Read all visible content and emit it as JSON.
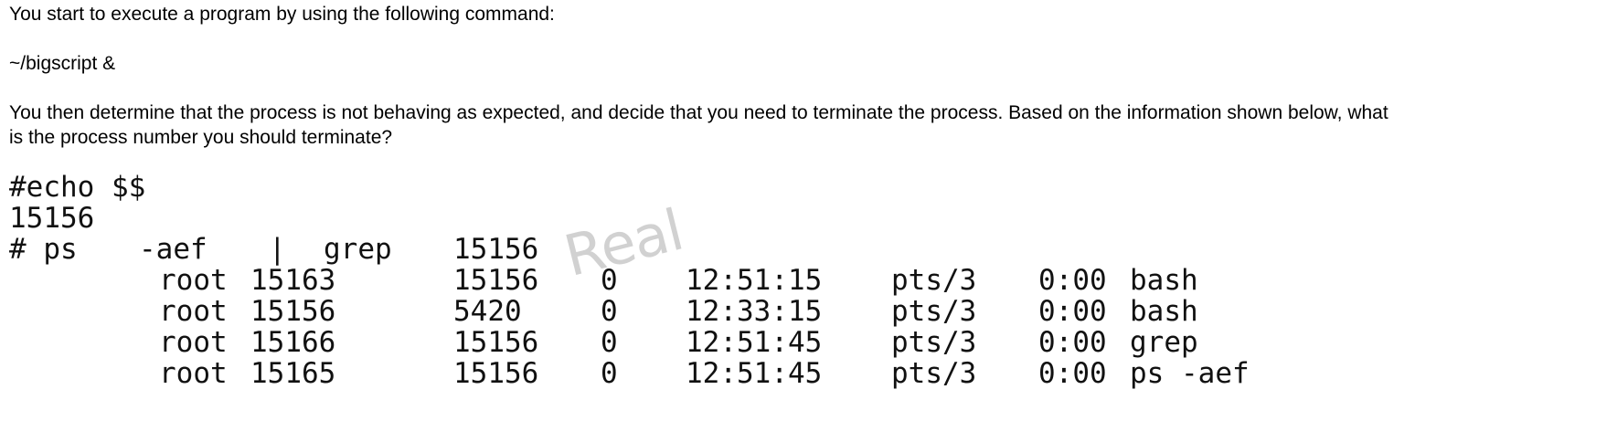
{
  "question": {
    "line1": "You start to execute a program by using the following command:",
    "command": "~/bigscript &",
    "line3a": "You then determine that the process is not behaving as expected, and decide that you need to terminate the process. Based on the information shown below, what",
    "line3b": "is the process number you should terminate?"
  },
  "terminal": {
    "echo_cmd": "#echo $$",
    "echo_output": "15156",
    "ps_prompt": "# ps",
    "ps_flags": "-aef",
    "ps_pipe": "|",
    "ps_grep": "grep",
    "ps_grep_arg": "15156",
    "rows": [
      {
        "user": "root",
        "pid": "15163",
        "ppid": "15156",
        "c": "0",
        "time": "12:51:15",
        "tty": "pts/3",
        "cpu": "0:00",
        "cmd": "bash"
      },
      {
        "user": "root",
        "pid": "15156",
        "ppid": "5420",
        "c": "0",
        "time": "12:33:15",
        "tty": "pts/3",
        "cpu": "0:00",
        "cmd": "bash"
      },
      {
        "user": "root",
        "pid": "15166",
        "ppid": "15156",
        "c": "0",
        "time": "12:51:45",
        "tty": "pts/3",
        "cpu": "0:00",
        "cmd": "grep"
      },
      {
        "user": "root",
        "pid": "15165",
        "ppid": "15156",
        "c": "0",
        "time": "12:51:45",
        "tty": "pts/3",
        "cpu": "0:00",
        "cmd": "ps -aef"
      }
    ]
  },
  "watermark": "Real"
}
